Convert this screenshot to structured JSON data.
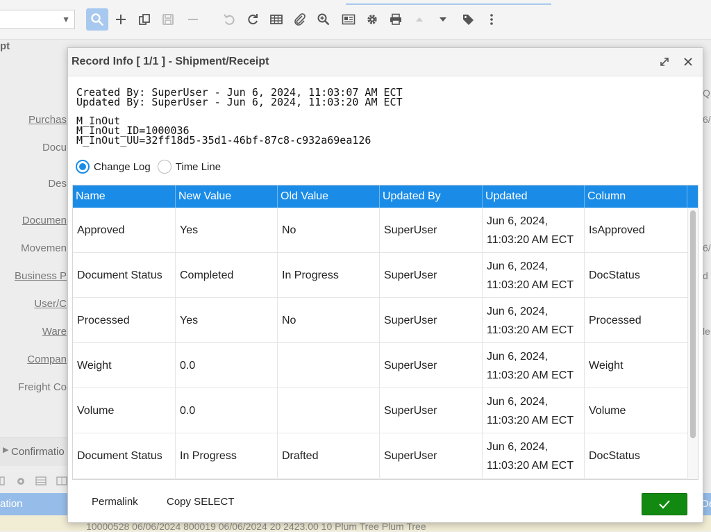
{
  "background": {
    "title_fragment": "pt",
    "labels": [
      {
        "text": "Purchas",
        "link": true
      },
      {
        "text": "Docu",
        "link": false
      },
      {
        "text": "Des",
        "link": false
      },
      {
        "text": "Documen",
        "link": true
      },
      {
        "text": "Movemen",
        "link": false
      },
      {
        "text": "Business P",
        "link": true
      },
      {
        "text": "User/C",
        "link": true
      },
      {
        "text": "Ware",
        "link": true
      },
      {
        "text": "Compan",
        "link": true
      },
      {
        "text": "Freight Co",
        "link": false
      }
    ],
    "right_fragments": [
      "Q",
      "6/",
      "6/",
      "d",
      "le"
    ],
    "tab_label": "Confirmatio",
    "grid_header_left": "ation",
    "grid_header_right": "Deta",
    "grid_row_text": "10000528  06/06/2024  800019  06/06/2024  20  2423.00          10  Plum Tree  Plum Tree"
  },
  "modal": {
    "title": "Record Info [ 1/1 ] - Shipment/Receipt",
    "created_by": "Created By: SuperUser - Jun 6, 2024, 11:03:07 AM ECT",
    "updated_by": "Updated By: SuperUser - Jun 6, 2024, 11:03:20 AM ECT",
    "table_name": "M_InOut",
    "record_id": "M_InOut_ID=1000036",
    "record_uu": "M_InOut_UU=32ff18d5-35d1-46bf-87c8-c932a69ea126",
    "view_options": {
      "change_log": "Change Log",
      "time_line": "Time Line"
    },
    "columns": [
      "Name",
      "New Value",
      "Old Value",
      "Updated By",
      "Updated",
      "Column"
    ],
    "rows": [
      {
        "name": "Approved",
        "new_value": "Yes",
        "old_value": "No",
        "updated_by": "SuperUser",
        "updated_date": "Jun 6, 2024,",
        "updated_time": "11:03:20 AM ECT",
        "column": "IsApproved"
      },
      {
        "name": "Document Status",
        "new_value": "Completed",
        "old_value": "In Progress",
        "updated_by": "SuperUser",
        "updated_date": "Jun 6, 2024,",
        "updated_time": "11:03:20 AM ECT",
        "column": "DocStatus"
      },
      {
        "name": "Processed",
        "new_value": "Yes",
        "old_value": "No",
        "updated_by": "SuperUser",
        "updated_date": "Jun 6, 2024,",
        "updated_time": "11:03:20 AM ECT",
        "column": "Processed"
      },
      {
        "name": "Weight",
        "new_value": "0.0",
        "old_value": "",
        "updated_by": "SuperUser",
        "updated_date": "Jun 6, 2024,",
        "updated_time": "11:03:20 AM ECT",
        "column": "Weight"
      },
      {
        "name": "Volume",
        "new_value": "0.0",
        "old_value": "",
        "updated_by": "SuperUser",
        "updated_date": "Jun 6, 2024,",
        "updated_time": "11:03:20 AM ECT",
        "column": "Volume"
      },
      {
        "name": "Document Status",
        "new_value": "In Progress",
        "old_value": "Drafted",
        "updated_by": "SuperUser",
        "updated_date": "Jun 6, 2024,",
        "updated_time": "11:03:20 AM ECT",
        "column": "DocStatus"
      }
    ],
    "footer": {
      "permalink": "Permalink",
      "copy_select": "Copy SELECT"
    }
  },
  "colors": {
    "accent": "#1a8ce8",
    "ok_button": "#128a12",
    "toolbar_active": "#a8c9ef"
  },
  "icons": [
    "search-icon",
    "plus-icon",
    "copy-icon",
    "save-icon",
    "minus-icon",
    "undo-icon",
    "refresh-icon",
    "grid-icon",
    "attachment-icon",
    "zoom-icon",
    "report-icon",
    "gear-icon",
    "print-icon",
    "arrow-up-icon",
    "arrow-down-icon",
    "tag-icon",
    "more-icon",
    "expand-icon",
    "close-icon",
    "check-icon"
  ]
}
